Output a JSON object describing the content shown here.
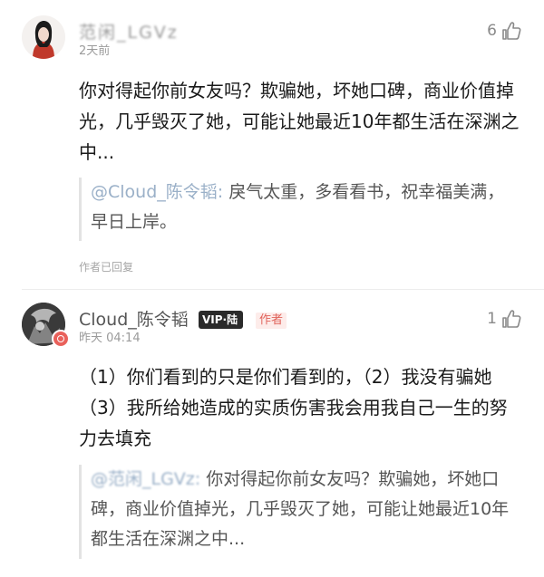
{
  "comments": [
    {
      "username": "范闲_LGVz",
      "time": "2天前",
      "likes": "6",
      "text": "你对得起你前女友吗？欺骗她，坏她口碑，商业价值掉光，几乎毁灭了她，可能让她最近10年都生活在深渊之中...",
      "reply_prefix": "@Cloud_陈令韬: ",
      "reply_text": "戾气太重，多看看书，祝幸福美满，早日上岸。",
      "status": "作者已回复"
    },
    {
      "username": "Cloud_陈令韬",
      "vip_badge": "VIP·陆",
      "author_tag": "作者",
      "time": "昨天 04:14",
      "likes": "1",
      "text": "（1）你们看到的只是你们看到的，（2）我没有骗她（3）我所给她造成的实质伤害我会用我自己一生的努力去填充",
      "quote_prefix": "@范闲_LGVz: ",
      "quote_text": "你对得起你前女友吗？欺骗她，坏她口碑，商业价值掉光，几乎毁灭了她，可能让她最近10年都生活在深渊之中..."
    }
  ]
}
